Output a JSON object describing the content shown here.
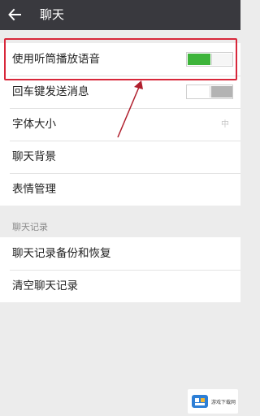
{
  "header": {
    "title": "聊天"
  },
  "settings": {
    "speaker_mode": {
      "label": "使用听筒播放语音",
      "enabled": true
    },
    "enter_to_send": {
      "label": "回车键发送消息",
      "enabled": false
    },
    "font_size": {
      "label": "字体大小",
      "value": "中"
    },
    "chat_background": {
      "label": "聊天背景"
    },
    "emoji_management": {
      "label": "表情管理"
    }
  },
  "history_section": {
    "title": "聊天记录",
    "backup_label": "聊天记录备份和恢复",
    "clear_label": "清空聊天记录"
  },
  "colors": {
    "topbar": "#39393e",
    "toggle_on": "#3db43a",
    "annotation": "#d8273a"
  },
  "watermark": {
    "text": "游戏下载网"
  }
}
